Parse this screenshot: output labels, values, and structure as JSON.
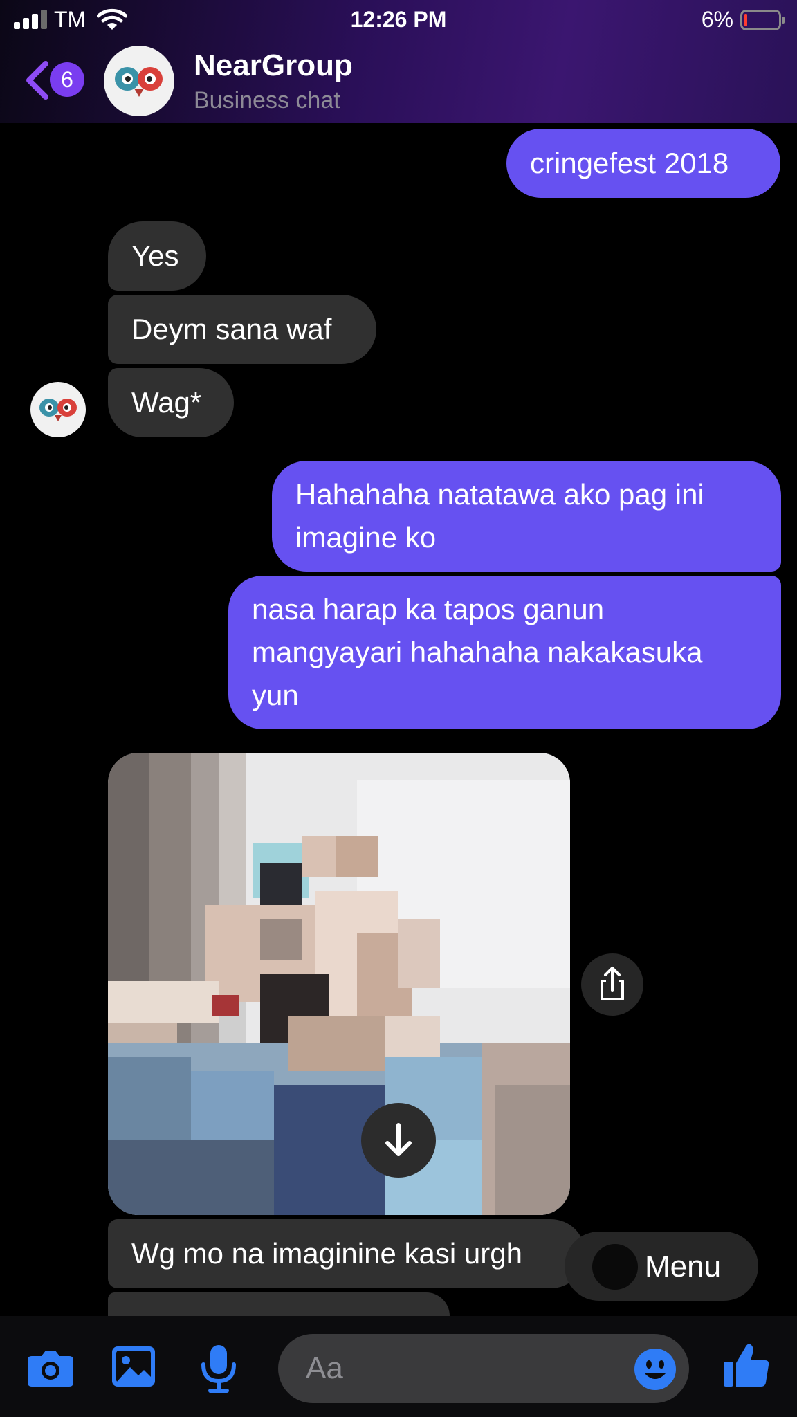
{
  "status_bar": {
    "carrier": "TM",
    "time": "12:26 PM",
    "battery_percent": "6%"
  },
  "header": {
    "back_count": "6",
    "title": "NearGroup",
    "subtitle": "Business chat"
  },
  "messages": [
    {
      "direction": "outgoing",
      "text": "cringefest 2018"
    },
    {
      "direction": "incoming",
      "text": "Yes"
    },
    {
      "direction": "incoming",
      "text": "Deym sana waf"
    },
    {
      "direction": "incoming",
      "text": "Wag*"
    },
    {
      "direction": "outgoing",
      "lines": [
        "Hahahaha natatawa ako pag ini",
        "imagine ko"
      ]
    },
    {
      "direction": "outgoing",
      "lines": [
        "nasa harap ka tapos ganun",
        "mangyayari hahahaha nakakasuka",
        "yun"
      ]
    },
    {
      "direction": "incoming",
      "type": "photo"
    },
    {
      "direction": "incoming",
      "text": "Wg mo na imaginine kasi urgh"
    }
  ],
  "menu_button": {
    "label": "Menu"
  },
  "composer": {
    "placeholder": "Aa"
  },
  "colors": {
    "outgoing_bubble": "#6651f1",
    "incoming_bubble": "#303030",
    "accent_blue": "#2f7cf6",
    "badge": "#7a3df0"
  }
}
